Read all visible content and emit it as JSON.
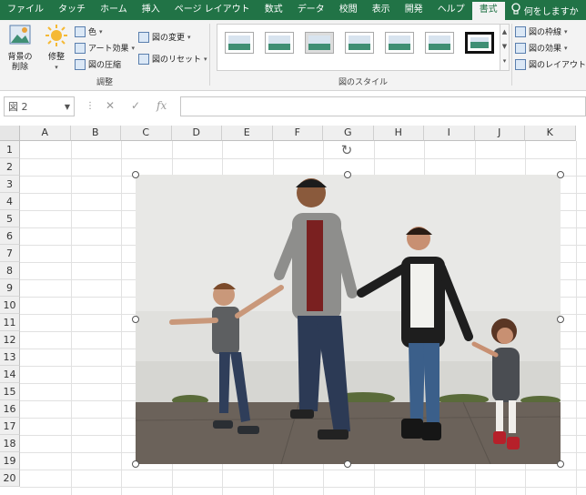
{
  "tabs": [
    "ファイル",
    "タッチ",
    "ホーム",
    "挿入",
    "ページ レイアウト",
    "数式",
    "データ",
    "校閲",
    "表示",
    "開発",
    "ヘルプ",
    "書式"
  ],
  "active_tab": "書式",
  "search_label": "何をしますか",
  "ribbon": {
    "remove_bg": "背景の\n削除",
    "corrections": "修整",
    "color": "色",
    "artistic": "アート効果",
    "compress": "図の圧縮",
    "change_picture": "図の変更",
    "reset_picture": "図のリセット",
    "adjust_group": "調整",
    "styles_group": "図のスタイル",
    "border": "図の枠線",
    "effects": "図の効果",
    "layout": "図のレイアウト"
  },
  "formula_bar": {
    "name_box": "図 2",
    "cancel": "✕",
    "enter": "✓",
    "fx": "fx",
    "value": ""
  },
  "columns": [
    "A",
    "B",
    "C",
    "D",
    "E",
    "F",
    "G",
    "H",
    "I",
    "J",
    "K"
  ],
  "rows": [
    "1",
    "2",
    "3",
    "4",
    "5",
    "6",
    "7",
    "8",
    "9",
    "10",
    "11",
    "12",
    "13",
    "14",
    "15",
    "16",
    "17",
    "18",
    "19",
    "20"
  ],
  "colors": {
    "accent": "#217346",
    "ribbon_bg": "#f3f3f3",
    "wall": "#e9e9e9",
    "ground": "#6b625a"
  }
}
